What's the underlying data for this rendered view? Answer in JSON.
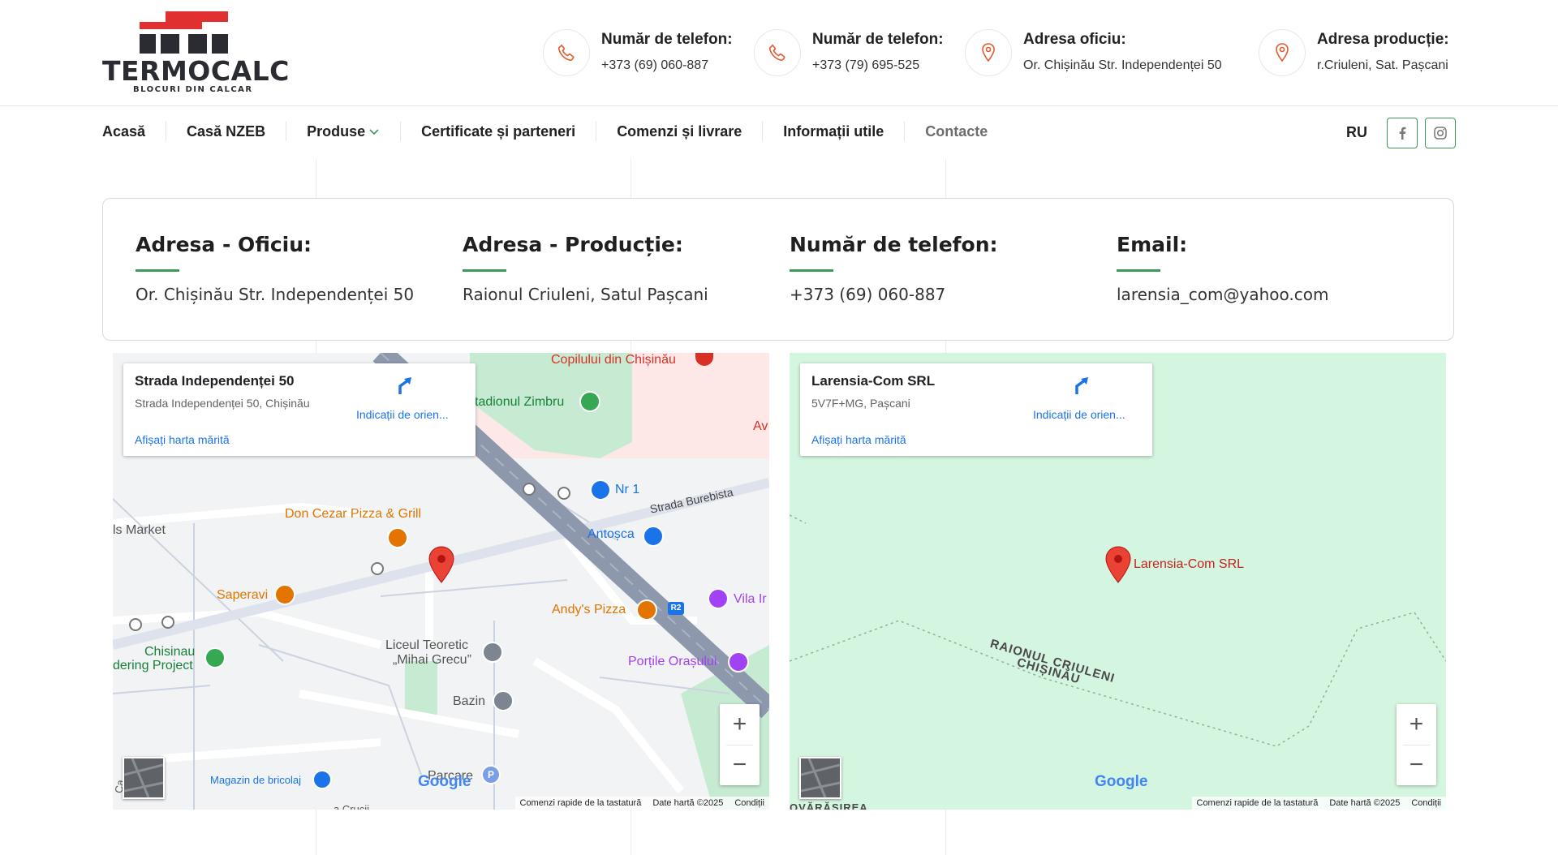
{
  "brand": {
    "name": "TERMOCALC",
    "tagline": "BLOCURI DIN CALCAR",
    "colors": {
      "red": "#e0302f",
      "dark": "#2a2c31",
      "green": "#3c9a55",
      "accent_icon": "#e35d2f"
    }
  },
  "header": {
    "contacts": [
      {
        "icon": "phone-icon",
        "title": "Număr de telefon:",
        "value": "+373 (69) 060-887"
      },
      {
        "icon": "phone-icon",
        "title": "Număr de telefon:",
        "value": "+373 (79) 695-525"
      },
      {
        "icon": "location-pin-icon",
        "title": "Adresa oficiu:",
        "value": "Or. Chișinău Str. Independenței 50"
      },
      {
        "icon": "location-pin-icon",
        "title": "Adresa producție:",
        "value": "r.Criuleni, Sat. Pașcani"
      }
    ]
  },
  "nav": {
    "items": [
      {
        "label": "Acasă"
      },
      {
        "label": "Casă NZEB"
      },
      {
        "label": "Produse",
        "dropdown": true
      },
      {
        "label": "Certificate și parteneri"
      },
      {
        "label": "Comenzi și livrare"
      },
      {
        "label": "Informații utile"
      },
      {
        "label": "Contacte",
        "active": true
      }
    ],
    "lang": "RU",
    "social": [
      "facebook-icon",
      "instagram-icon"
    ]
  },
  "info": {
    "columns": [
      {
        "title": "Adresa - Oficiu:",
        "value": "Or. Chișinău Str. Independenței 50"
      },
      {
        "title": "Adresa - Producție:",
        "value": "Raionul Criuleni, Satul Pașcani"
      },
      {
        "title": "Număr de telefon:",
        "value": "+373 (69) 060-887"
      },
      {
        "title": "Email:",
        "value": "larensia_com@yahoo.com"
      }
    ]
  },
  "map1": {
    "card": {
      "title": "Strada Independenței 50",
      "subtitle": "Strada Independenței 50, Chișinău",
      "directions": "Indicații de orien...",
      "larger_map": "Afișați harta mărită"
    },
    "labels": {
      "copilului": "Copilului din Chișinău",
      "stadion": "tadionul Zimbru",
      "av": "Av",
      "nr1": "Nr 1",
      "burebista": "Strada Burebista",
      "market": "ls Market",
      "doncezar": "Don Cezar Pizza & Grill",
      "antosca": "Antoșca",
      "saperavi": "Saperavi",
      "andys": "Andy's Pizza",
      "vila": "Vila Ir",
      "r2": "R2",
      "chisinau1": "Chisinau",
      "chisinau2": "dering Project",
      "liceu1": "Liceul Teoretic",
      "liceu2": "„Mihai Grecu”",
      "portile": "Porțile Orașului",
      "bazin": "Bazin",
      "bricolaj": "Magazin de bricolaj",
      "parcare": "Parcare",
      "crucii": "a Crucii",
      "ca": "Ca"
    },
    "attribution": [
      "Comenzi rapide de la tastatură",
      "Date hartă ©2025",
      "Condiții"
    ],
    "google": "Google"
  },
  "map2": {
    "card": {
      "title": "Larensia-Com SRL",
      "subtitle": "5V7F+MG, Pașcani",
      "directions": "Indicații de orien...",
      "larger_map": "Afișați harta mărită"
    },
    "labels": {
      "marker": "Larensia-Com SRL",
      "raion1": "RAIONUL CRIULENI",
      "raion2": "CHIȘINĂU",
      "bottom": "OVĂRĂȘIREA"
    },
    "attribution": [
      "Comenzi rapide de la tastatură",
      "Date hartă ©2025",
      "Condiții"
    ],
    "google": "Google"
  }
}
